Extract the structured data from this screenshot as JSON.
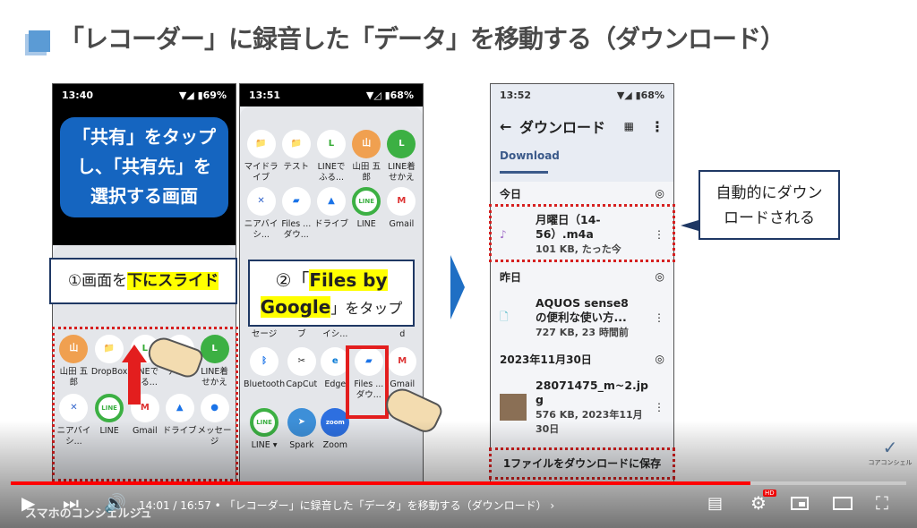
{
  "slide": {
    "title": "「レコーダー」に録音した「データ」を移動する（ダウンロード）",
    "phone1": {
      "time": "13:40",
      "battery": "69%",
      "banner_lines": [
        "「共有」をタップ",
        "し、「共有先」を",
        "選択する画面"
      ],
      "callout_prefix": "①画面を",
      "callout_highlight": "下にスライド",
      "apps": [
        "山田 五郎",
        "DropBox",
        "LINEでふる...",
        "テスト",
        "LINE着せかえ",
        "ニアバイシ...",
        "LINE",
        "Gmail",
        "ドライブ",
        "メッセージ"
      ]
    },
    "phone2": {
      "time": "13:51",
      "battery": "68%",
      "apps_row1": [
        "マイドライブ",
        "テスト",
        "LINEでふる...",
        "山田 五郎",
        "LINE着せかえ"
      ],
      "apps_row2": [
        "ニアバイシ...",
        "Files ...ダウ...",
        "ドライブ",
        "LINE",
        "Gmail"
      ],
      "apps_row3": [
        "セージ",
        "ブ",
        "イシ...",
        "",
        "d"
      ],
      "apps_row4": [
        "Bluetooth",
        "CapCut",
        "Edge",
        "Files ...ダウ...",
        "Gmail"
      ],
      "apps_row5": [
        "LINE ▾",
        "Spark",
        "Zoom"
      ],
      "callout_prefix": "②「",
      "callout_highlight1": "Files by",
      "callout_highlight2": "Google",
      "callout_suffix": "」をタップ"
    },
    "phone3": {
      "time": "13:52",
      "battery": "68%",
      "header": "ダウンロード",
      "tab": "Download",
      "sections": [
        {
          "label": "今日",
          "file": "月曜日（14-56）.m4a",
          "file_line1": "月曜日",
          "file_line2": "（14-56）.m4a",
          "meta": "101 KB, たった今"
        },
        {
          "label": "昨日",
          "file_line1": "AQUOS sense8",
          "file_line2": "の便利な使い方...",
          "meta": "727 KB, 23 時間前"
        },
        {
          "label": "2023年11月30日",
          "file_line1": "28071475_m~2.jp",
          "file_line2": "g",
          "meta": "576 KB, 2023年11月",
          "meta2": "30日"
        }
      ],
      "save_label": "1ファイルをダウンロードに保存"
    },
    "callout3_lines": [
      "自動的にダウン",
      "ロードされる"
    ],
    "logo_text": "コアコンシェル"
  },
  "player": {
    "time_current": "14:01",
    "time_total": "16:57",
    "chapter": "「レコーダー」に録音した「データ」を移動する（ダウンロード）",
    "progress": 0.826,
    "hd_badge": "HD",
    "watermark": "スマホのコンシェルジュ",
    "colors": {
      "progress": "#ff0000",
      "accent": "#5b9bd5"
    }
  }
}
